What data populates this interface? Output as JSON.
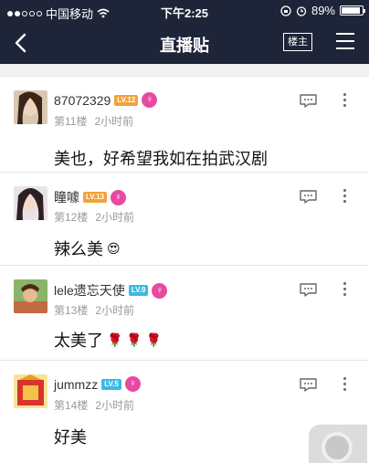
{
  "status_bar": {
    "carrier": "中国移动",
    "time": "下午2:25",
    "battery": "89%",
    "battery_level": 0.89
  },
  "nav": {
    "title": "直播贴",
    "owner_label": "楼主"
  },
  "posts": [
    {
      "username": "87072329",
      "level": "LV.12",
      "level_color": "#f2a23b",
      "floor": "第11楼",
      "time": "2小时前",
      "content": "美也，好希望我如在拍武汉剧",
      "emoji": ""
    },
    {
      "username": "瞳噱",
      "level": "LV.13",
      "level_color": "#f2a23b",
      "floor": "第12楼",
      "time": "2小时前",
      "content": "辣么美",
      "emoji": "😍"
    },
    {
      "username": "lele遗忘天使",
      "level": "LV.9",
      "level_color": "#3cb9e6",
      "floor": "第13楼",
      "time": "2小时前",
      "content": "太美了",
      "emoji": "🌹 🌹 🌹"
    },
    {
      "username": "jummzz",
      "level": "LV.5",
      "level_color": "#3cb9e6",
      "floor": "第14楼",
      "time": "2小时前",
      "content": "好美",
      "emoji": ""
    }
  ],
  "colors": {
    "nav_bg": "#1f2538",
    "female_badge": "#e74aa1"
  }
}
